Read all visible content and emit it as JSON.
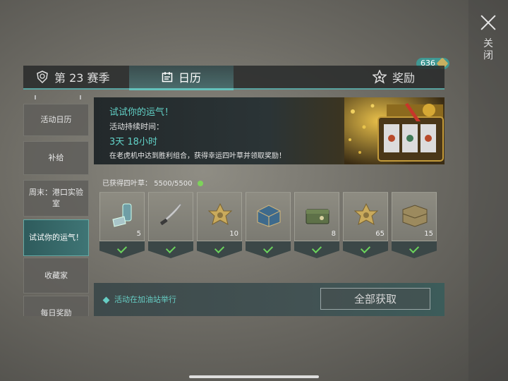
{
  "close": {
    "label": "关闭"
  },
  "tabs": [
    {
      "label": "第 23 赛季",
      "icon": "season-shield-icon"
    },
    {
      "label": "日历",
      "icon": "calendar-icon"
    },
    {
      "label": "奖励",
      "icon": "star-icon"
    }
  ],
  "badge": {
    "count": "636",
    "icon": "clover-icon"
  },
  "sidebar": {
    "items": [
      {
        "label": "活动日历"
      },
      {
        "label": "补给"
      },
      {
        "label": "周末：港口实验室"
      },
      {
        "label": "试试你的运气！",
        "active": true
      },
      {
        "label": "收藏家"
      },
      {
        "label": "每日奖励"
      }
    ]
  },
  "banner": {
    "title": "试试你的运气！",
    "duration_label": "活动持续时间：",
    "duration": "3天 18小时",
    "description": "在老虎机中达到胜利组合，获得幸运四叶草并领取奖励！"
  },
  "progress": {
    "label": "已获得四叶草：",
    "value": "5500/5500"
  },
  "rewards": [
    {
      "item": "inhaler",
      "qty": "5",
      "claimed": true
    },
    {
      "item": "machete",
      "qty": "",
      "claimed": true
    },
    {
      "item": "gear-part",
      "qty": "10",
      "claimed": true
    },
    {
      "item": "supply-crate-blue",
      "qty": "",
      "claimed": true
    },
    {
      "item": "ammo-box",
      "qty": "8",
      "claimed": true
    },
    {
      "item": "gear-part",
      "qty": "65",
      "claimed": true
    },
    {
      "item": "wooden-crate",
      "qty": "15",
      "claimed": true
    }
  ],
  "footer": {
    "note": "活动在加油站举行",
    "claim_all": "全部获取"
  },
  "colors": {
    "accent": "#62d2c8",
    "check": "#6bd25c",
    "tab_active": "#4a6b6b"
  }
}
